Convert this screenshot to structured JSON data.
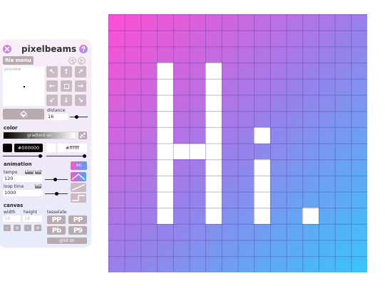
{
  "app": {
    "title": "pixelbeams"
  },
  "toolbar": {
    "file_menu_label": "file menu"
  },
  "preview": {
    "label": "preview"
  },
  "distance": {
    "label": "distance",
    "value": "16",
    "slider_fraction": 0.7
  },
  "color": {
    "section_label": "color",
    "gradient_label": "gradient on",
    "color1_hex": "#000000",
    "color2_hex": "#ffffff",
    "color1_slider_fraction": 0.9,
    "color2_slider_fraction": 0.95
  },
  "animation": {
    "section_label": "animation",
    "toggle_label": "on",
    "tempo_label": "tempo",
    "bpm_tag": "BPM",
    "ms_tag": "MS",
    "tempo_value": "120",
    "tempo_slider_fraction": 0.4,
    "loop_label": "loop time",
    "loop_ms_tag": "MS",
    "loop_value": "1000",
    "loop_slider_fraction": 0.45
  },
  "canvas_section": {
    "section_label": "canvas",
    "width_label": "width",
    "height_label": "height",
    "width_value": "16",
    "height_value": "16",
    "tesselate_label": "tesselate",
    "grid_label": "grid on",
    "minus_symbol": "-",
    "plus_symbol": "+"
  },
  "tesselate_options": [
    "PP",
    "PP",
    "Pb",
    "P9"
  ],
  "colors": {
    "gradient_start": "#ff4fd4",
    "gradient_mid": "#9b7fea",
    "gradient_end": "#38c5fb",
    "accent_gradient": [
      "#f35cc8",
      "#4ba5f6"
    ],
    "button_grey": "#b9aab0"
  },
  "grid": {
    "cols": 16,
    "rows": 16,
    "show_grid": true
  },
  "pixels": [
    [
      3,
      3
    ],
    [
      3,
      4
    ],
    [
      3,
      5
    ],
    [
      3,
      6
    ],
    [
      3,
      7
    ],
    [
      3,
      8
    ],
    [
      3,
      9
    ],
    [
      3,
      10
    ],
    [
      3,
      11
    ],
    [
      3,
      12
    ],
    [
      6,
      3
    ],
    [
      6,
      4
    ],
    [
      6,
      5
    ],
    [
      6,
      6
    ],
    [
      6,
      7
    ],
    [
      6,
      8
    ],
    [
      6,
      9
    ],
    [
      6,
      10
    ],
    [
      6,
      11
    ],
    [
      6,
      12
    ],
    [
      4,
      8
    ],
    [
      5,
      8
    ],
    [
      9,
      7
    ],
    [
      9,
      9
    ],
    [
      9,
      10
    ],
    [
      9,
      11
    ],
    [
      9,
      12
    ],
    [
      12,
      12
    ]
  ]
}
